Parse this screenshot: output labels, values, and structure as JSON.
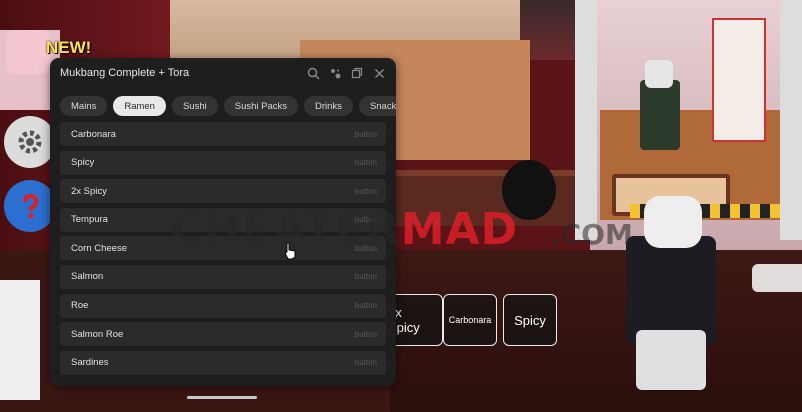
{
  "hud": {
    "new_badge": "NEW!"
  },
  "panel": {
    "title": "Mukbang Complete + Tora",
    "header_icons": [
      "search-icon",
      "gamepad-icon",
      "minimize-icon",
      "close-icon"
    ],
    "tabs": [
      {
        "label": "Mains",
        "active": false
      },
      {
        "label": "Ramen",
        "active": true
      },
      {
        "label": "Sushi",
        "active": false
      },
      {
        "label": "Sushi Packs",
        "active": false
      },
      {
        "label": "Drinks",
        "active": false
      },
      {
        "label": "Snacks",
        "active": false
      }
    ],
    "items": [
      {
        "label": "Carbonara",
        "type": "button"
      },
      {
        "label": "Spicy",
        "type": "button"
      },
      {
        "label": "2x Spicy",
        "type": "button"
      },
      {
        "label": "Tempura",
        "type": "button"
      },
      {
        "label": "Corn Cheese",
        "type": "button"
      },
      {
        "label": "Salmon",
        "type": "button"
      },
      {
        "label": "Roe",
        "type": "button"
      },
      {
        "label": "Salmon Roe",
        "type": "button"
      },
      {
        "label": "Sardines",
        "type": "button"
      }
    ]
  },
  "game_buttons": [
    "2x Spicy",
    "Carbonara",
    "Spicy"
  ],
  "watermark": {
    "part1": "CHEATER",
    "part2": "MAD",
    "part3": ".COM"
  },
  "colors": {
    "panel_bg": "#1e1e1e",
    "tab_active": "#e9e9e9",
    "item_bg": "#2b2b2b",
    "watermark_red": "#dc1e28"
  }
}
